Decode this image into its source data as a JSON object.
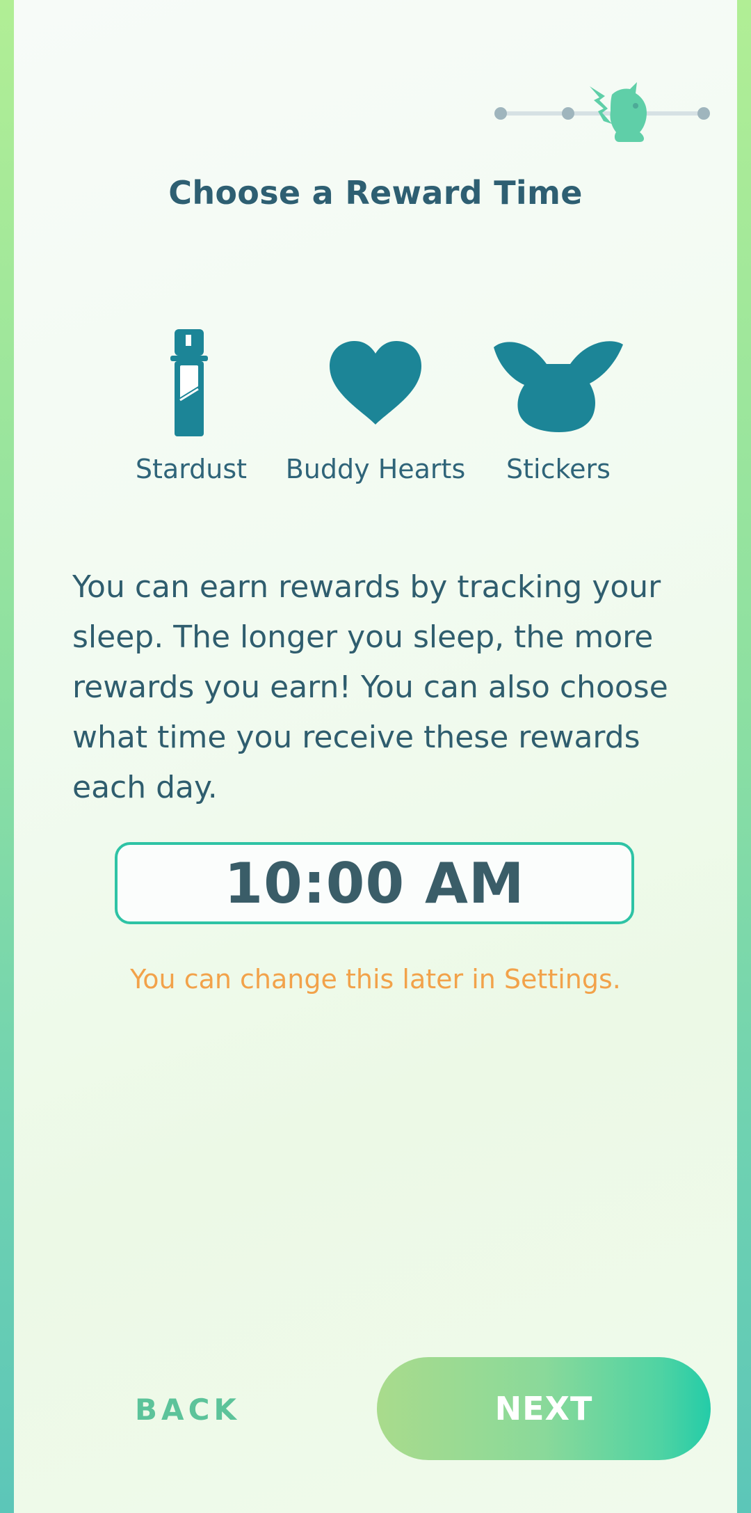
{
  "progress": {
    "total_steps": 4,
    "current_step": 3
  },
  "title": "Choose a Reward Time",
  "rewards": [
    {
      "label": "Stardust",
      "icon": "stardust-vial-icon"
    },
    {
      "label": "Buddy Hearts",
      "icon": "heart-icon"
    },
    {
      "label": "Stickers",
      "icon": "pikachu-head-icon"
    }
  ],
  "description": "You can earn rewards by tracking your sleep. The longer you sleep, the more rewards you earn! You can also choose what time you receive these rewards each day.",
  "time_picker": {
    "value": "10:00 AM"
  },
  "hint": "You can change this later in Settings.",
  "buttons": {
    "back": "BACK",
    "next": "NEXT"
  },
  "colors": {
    "icon": "#1c8597",
    "title": "#2e5f72",
    "accent": "#2ec3a5",
    "hint": "#f2a24a",
    "progress_inactive": "#9fb5bd",
    "progress_active": "#5fcfa8"
  }
}
